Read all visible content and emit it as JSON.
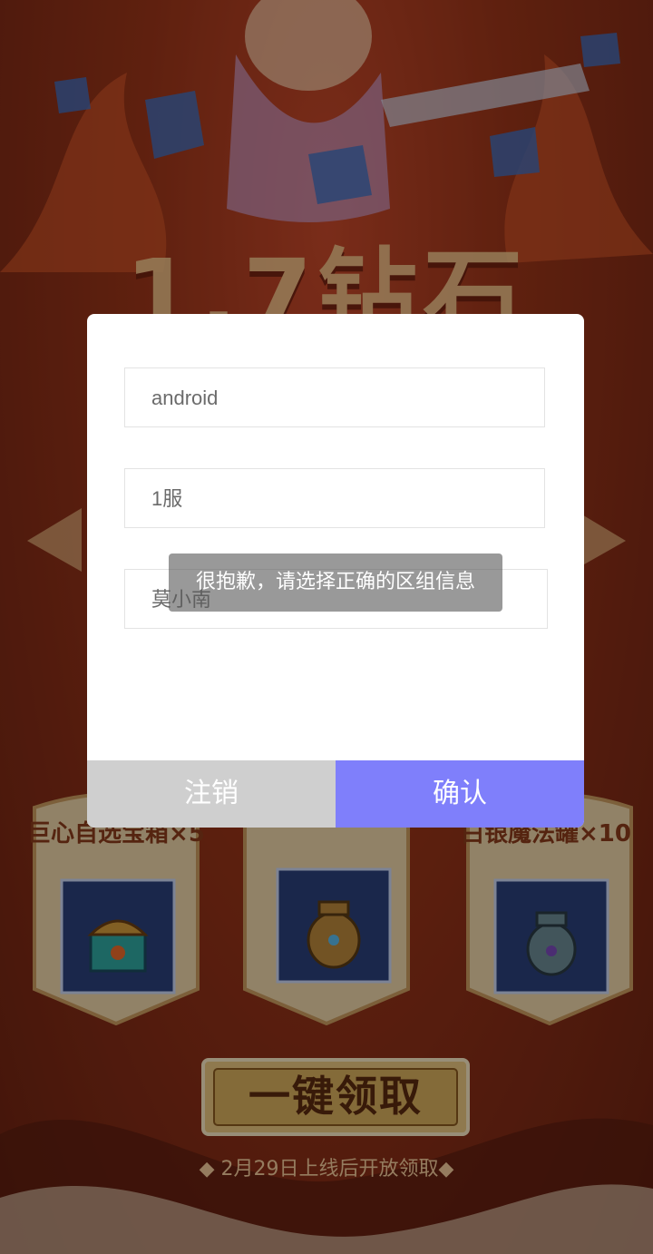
{
  "background": {
    "headline": "1.7钻石",
    "rewards": [
      {
        "label": "巨心自选宝箱×5",
        "icon": "treasure-chest-icon"
      },
      {
        "label": "",
        "icon": "golden-urn-icon"
      },
      {
        "label": "白银魔法罐×10",
        "icon": "silver-jar-icon"
      }
    ],
    "claim_button": "一键领取",
    "footer_note": "◆ 2月29日上线后开放领取◆"
  },
  "dialog": {
    "fields": {
      "platform": "android",
      "server": "1服",
      "role": "莫小南"
    },
    "cancel_label": "注销",
    "confirm_label": "确认"
  },
  "toast": {
    "message": "很抱歉，请选择正确的区组信息"
  },
  "colors": {
    "confirm": "#7f7ffb",
    "cancel": "#cfcfcf",
    "background_red": "#b9401f"
  }
}
